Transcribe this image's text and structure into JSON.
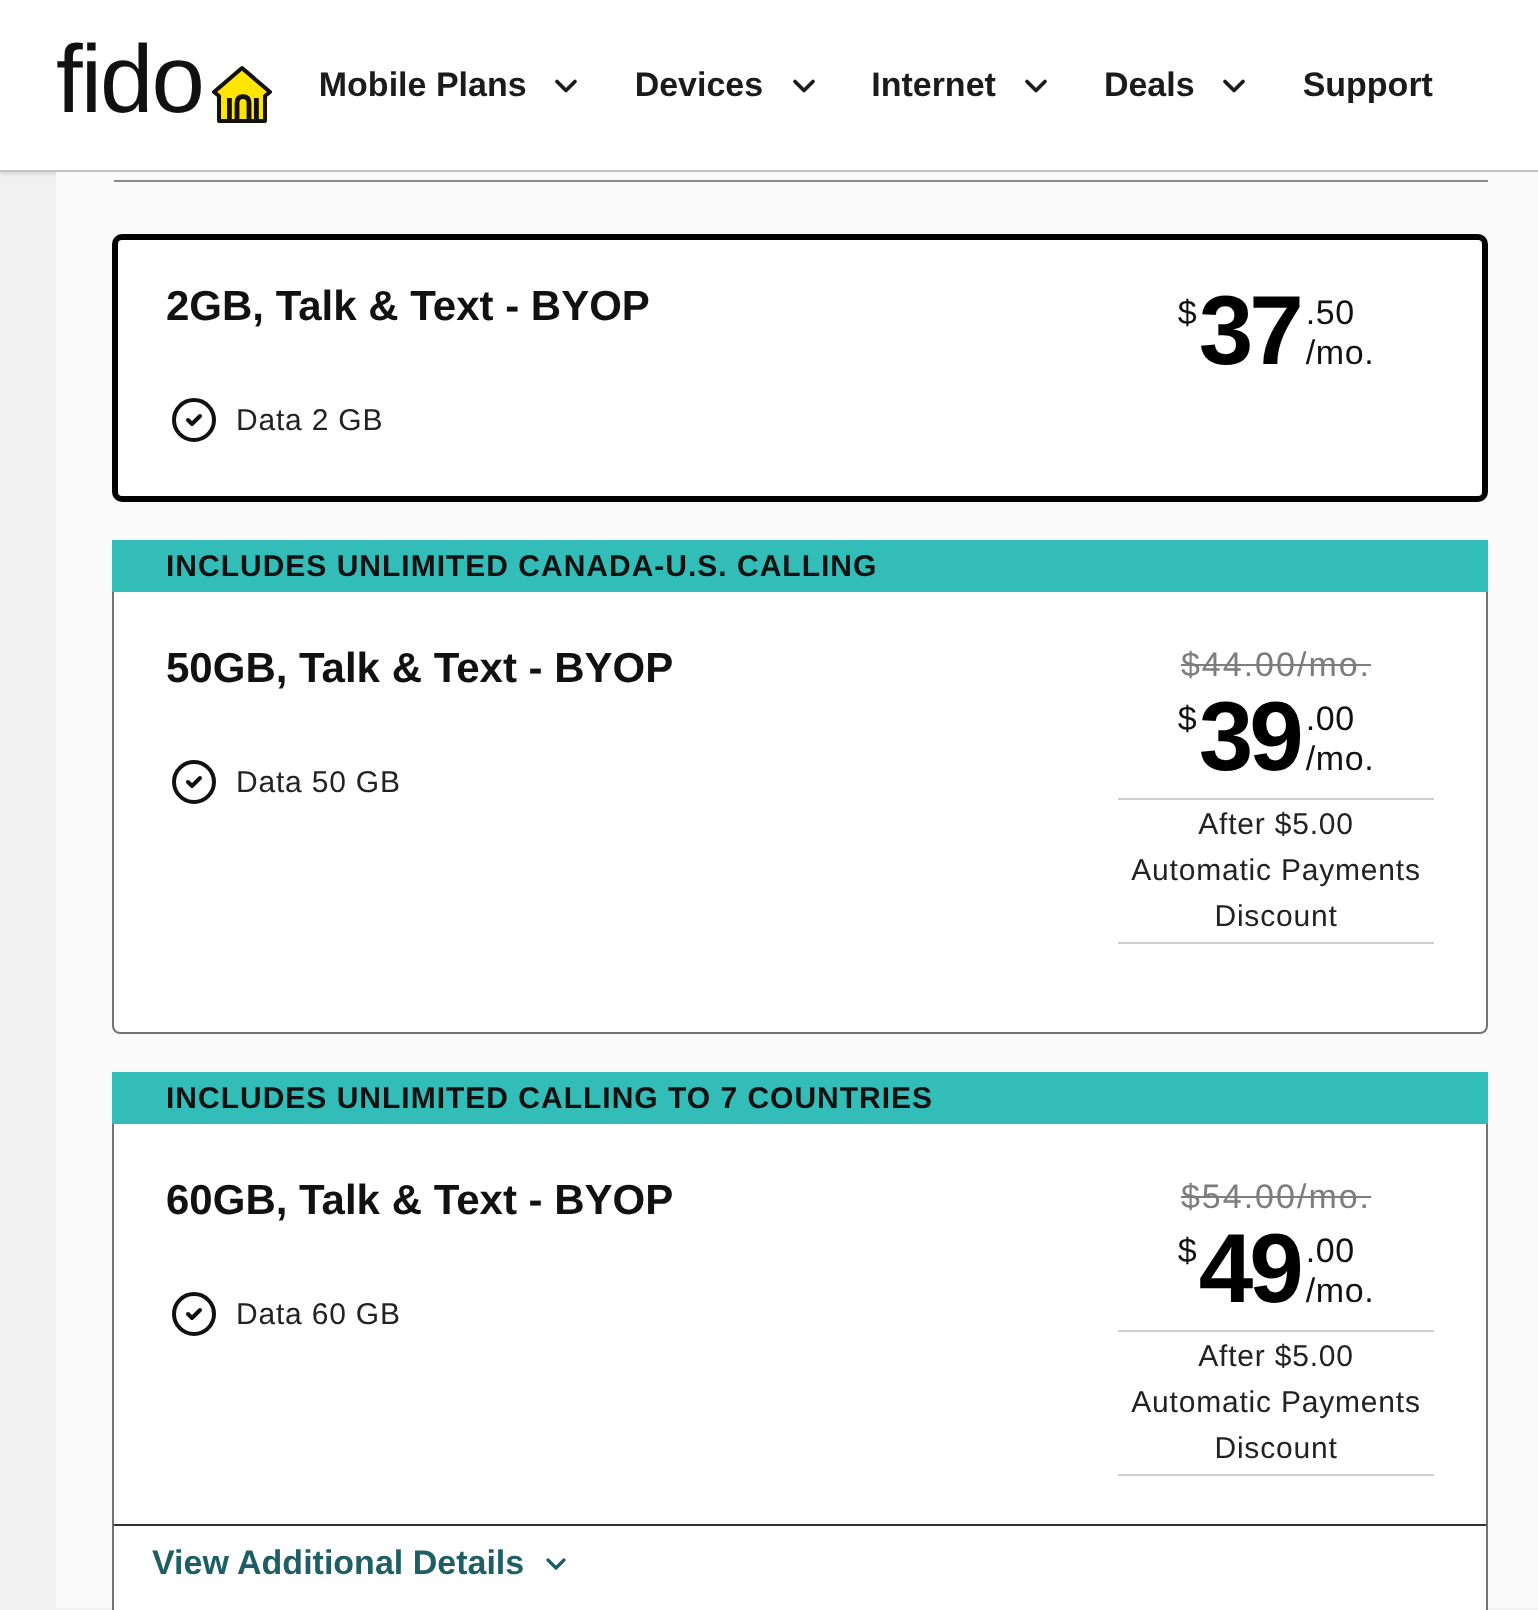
{
  "header": {
    "logo": "fido",
    "nav": [
      {
        "label": "Mobile Plans",
        "kind": "dropdown"
      },
      {
        "label": "Devices",
        "kind": "dropdown"
      },
      {
        "label": "Internet",
        "kind": "dropdown"
      },
      {
        "label": "Deals",
        "kind": "dropdown"
      },
      {
        "label": "Support",
        "kind": "link"
      }
    ]
  },
  "plans": [
    {
      "selected": true,
      "name": "2GB, Talk & Text - BYOP",
      "features": [
        "Data 2 GB"
      ],
      "price": {
        "currency": "$",
        "dollars": "37",
        "cents": ".50",
        "period": "/mo."
      }
    },
    {
      "selected": false,
      "banner": "INCLUDES UNLIMITED CANADA-U.S. CALLING",
      "name": "50GB, Talk & Text - BYOP",
      "features": [
        "Data 50 GB"
      ],
      "original_price": "$44.00/mo.",
      "price": {
        "currency": "$",
        "dollars": "39",
        "cents": ".00",
        "period": "/mo."
      },
      "discount_note": [
        "After $5.00",
        "Automatic Payments",
        "Discount"
      ]
    },
    {
      "selected": false,
      "banner": "INCLUDES UNLIMITED CALLING TO 7 COUNTRIES",
      "name": "60GB, Talk & Text - BYOP",
      "features": [
        "Data 60 GB"
      ],
      "original_price": "$54.00/mo.",
      "price": {
        "currency": "$",
        "dollars": "49",
        "cents": ".00",
        "period": "/mo."
      },
      "discount_note": [
        "After $5.00",
        "Automatic Payments",
        "Discount"
      ],
      "details_link": "View Additional Details"
    }
  ]
}
